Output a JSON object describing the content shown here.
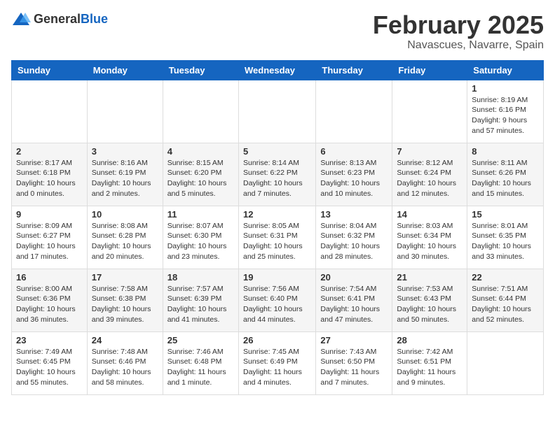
{
  "logo": {
    "general": "General",
    "blue": "Blue"
  },
  "header": {
    "month": "February 2025",
    "location": "Navascues, Navarre, Spain"
  },
  "weekdays": [
    "Sunday",
    "Monday",
    "Tuesday",
    "Wednesday",
    "Thursday",
    "Friday",
    "Saturday"
  ],
  "weeks": [
    [
      {
        "day": "",
        "info": ""
      },
      {
        "day": "",
        "info": ""
      },
      {
        "day": "",
        "info": ""
      },
      {
        "day": "",
        "info": ""
      },
      {
        "day": "",
        "info": ""
      },
      {
        "day": "",
        "info": ""
      },
      {
        "day": "1",
        "info": "Sunrise: 8:19 AM\nSunset: 6:16 PM\nDaylight: 9 hours and 57 minutes."
      }
    ],
    [
      {
        "day": "2",
        "info": "Sunrise: 8:17 AM\nSunset: 6:18 PM\nDaylight: 10 hours and 0 minutes."
      },
      {
        "day": "3",
        "info": "Sunrise: 8:16 AM\nSunset: 6:19 PM\nDaylight: 10 hours and 2 minutes."
      },
      {
        "day": "4",
        "info": "Sunrise: 8:15 AM\nSunset: 6:20 PM\nDaylight: 10 hours and 5 minutes."
      },
      {
        "day": "5",
        "info": "Sunrise: 8:14 AM\nSunset: 6:22 PM\nDaylight: 10 hours and 7 minutes."
      },
      {
        "day": "6",
        "info": "Sunrise: 8:13 AM\nSunset: 6:23 PM\nDaylight: 10 hours and 10 minutes."
      },
      {
        "day": "7",
        "info": "Sunrise: 8:12 AM\nSunset: 6:24 PM\nDaylight: 10 hours and 12 minutes."
      },
      {
        "day": "8",
        "info": "Sunrise: 8:11 AM\nSunset: 6:26 PM\nDaylight: 10 hours and 15 minutes."
      }
    ],
    [
      {
        "day": "9",
        "info": "Sunrise: 8:09 AM\nSunset: 6:27 PM\nDaylight: 10 hours and 17 minutes."
      },
      {
        "day": "10",
        "info": "Sunrise: 8:08 AM\nSunset: 6:28 PM\nDaylight: 10 hours and 20 minutes."
      },
      {
        "day": "11",
        "info": "Sunrise: 8:07 AM\nSunset: 6:30 PM\nDaylight: 10 hours and 23 minutes."
      },
      {
        "day": "12",
        "info": "Sunrise: 8:05 AM\nSunset: 6:31 PM\nDaylight: 10 hours and 25 minutes."
      },
      {
        "day": "13",
        "info": "Sunrise: 8:04 AM\nSunset: 6:32 PM\nDaylight: 10 hours and 28 minutes."
      },
      {
        "day": "14",
        "info": "Sunrise: 8:03 AM\nSunset: 6:34 PM\nDaylight: 10 hours and 30 minutes."
      },
      {
        "day": "15",
        "info": "Sunrise: 8:01 AM\nSunset: 6:35 PM\nDaylight: 10 hours and 33 minutes."
      }
    ],
    [
      {
        "day": "16",
        "info": "Sunrise: 8:00 AM\nSunset: 6:36 PM\nDaylight: 10 hours and 36 minutes."
      },
      {
        "day": "17",
        "info": "Sunrise: 7:58 AM\nSunset: 6:38 PM\nDaylight: 10 hours and 39 minutes."
      },
      {
        "day": "18",
        "info": "Sunrise: 7:57 AM\nSunset: 6:39 PM\nDaylight: 10 hours and 41 minutes."
      },
      {
        "day": "19",
        "info": "Sunrise: 7:56 AM\nSunset: 6:40 PM\nDaylight: 10 hours and 44 minutes."
      },
      {
        "day": "20",
        "info": "Sunrise: 7:54 AM\nSunset: 6:41 PM\nDaylight: 10 hours and 47 minutes."
      },
      {
        "day": "21",
        "info": "Sunrise: 7:53 AM\nSunset: 6:43 PM\nDaylight: 10 hours and 50 minutes."
      },
      {
        "day": "22",
        "info": "Sunrise: 7:51 AM\nSunset: 6:44 PM\nDaylight: 10 hours and 52 minutes."
      }
    ],
    [
      {
        "day": "23",
        "info": "Sunrise: 7:49 AM\nSunset: 6:45 PM\nDaylight: 10 hours and 55 minutes."
      },
      {
        "day": "24",
        "info": "Sunrise: 7:48 AM\nSunset: 6:46 PM\nDaylight: 10 hours and 58 minutes."
      },
      {
        "day": "25",
        "info": "Sunrise: 7:46 AM\nSunset: 6:48 PM\nDaylight: 11 hours and 1 minute."
      },
      {
        "day": "26",
        "info": "Sunrise: 7:45 AM\nSunset: 6:49 PM\nDaylight: 11 hours and 4 minutes."
      },
      {
        "day": "27",
        "info": "Sunrise: 7:43 AM\nSunset: 6:50 PM\nDaylight: 11 hours and 7 minutes."
      },
      {
        "day": "28",
        "info": "Sunrise: 7:42 AM\nSunset: 6:51 PM\nDaylight: 11 hours and 9 minutes."
      },
      {
        "day": "",
        "info": ""
      }
    ]
  ]
}
